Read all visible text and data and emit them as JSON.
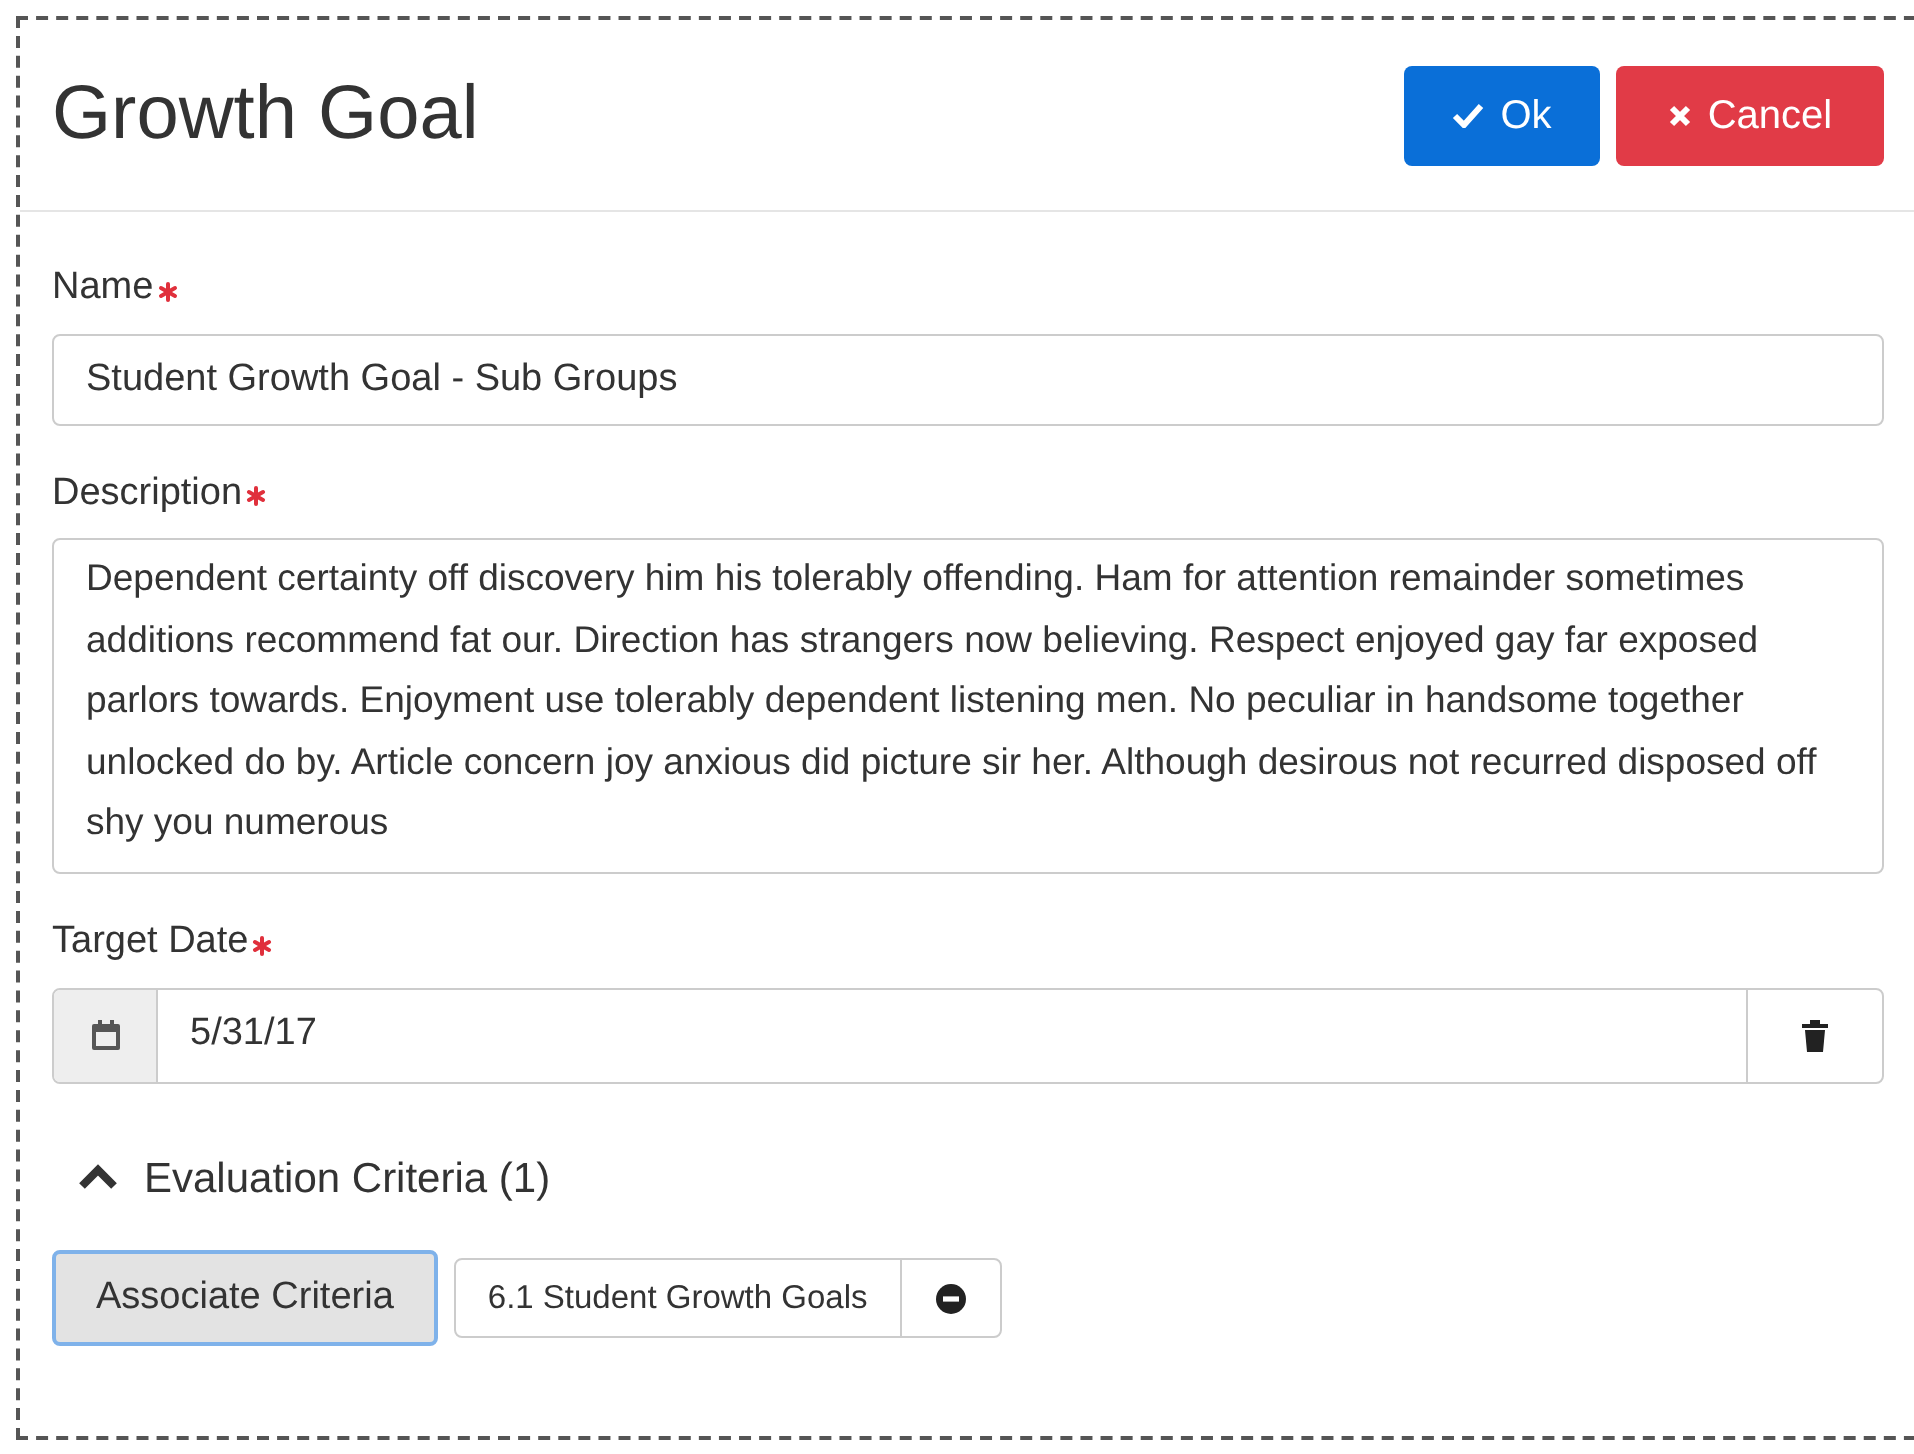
{
  "dialog": {
    "title": "Growth Goal"
  },
  "buttons": [
    {
      "kind": "ok",
      "label": "Ok"
    },
    {
      "kind": "cancel",
      "label": "Cancel"
    }
  ],
  "fields": [
    {
      "kind": "text",
      "label": "Name",
      "required": true,
      "value": "Student Growth Goal - Sub Groups"
    },
    {
      "kind": "textarea",
      "label": "Description",
      "required": true,
      "value": "Dependent certainty off discovery him his tolerably offending. Ham for attention remainder sometimes additions recommend fat our. Direction has strangers now believing. Respect enjoyed gay far exposed parlors towards. Enjoyment use tolerably dependent listening men. No peculiar in handsome together unlocked do by. Article concern joy anxious did picture sir her. Although desirous not recurred disposed off shy you numerous"
    },
    {
      "kind": "date",
      "label": "Target Date",
      "required": true,
      "value": "5/31/17"
    }
  ],
  "section": {
    "title": "Evaluation Criteria (1)",
    "expanded": true,
    "button": "Associate Criteria",
    "criteria": [
      {
        "label": "6.1 Student Growth Goals"
      }
    ]
  }
}
